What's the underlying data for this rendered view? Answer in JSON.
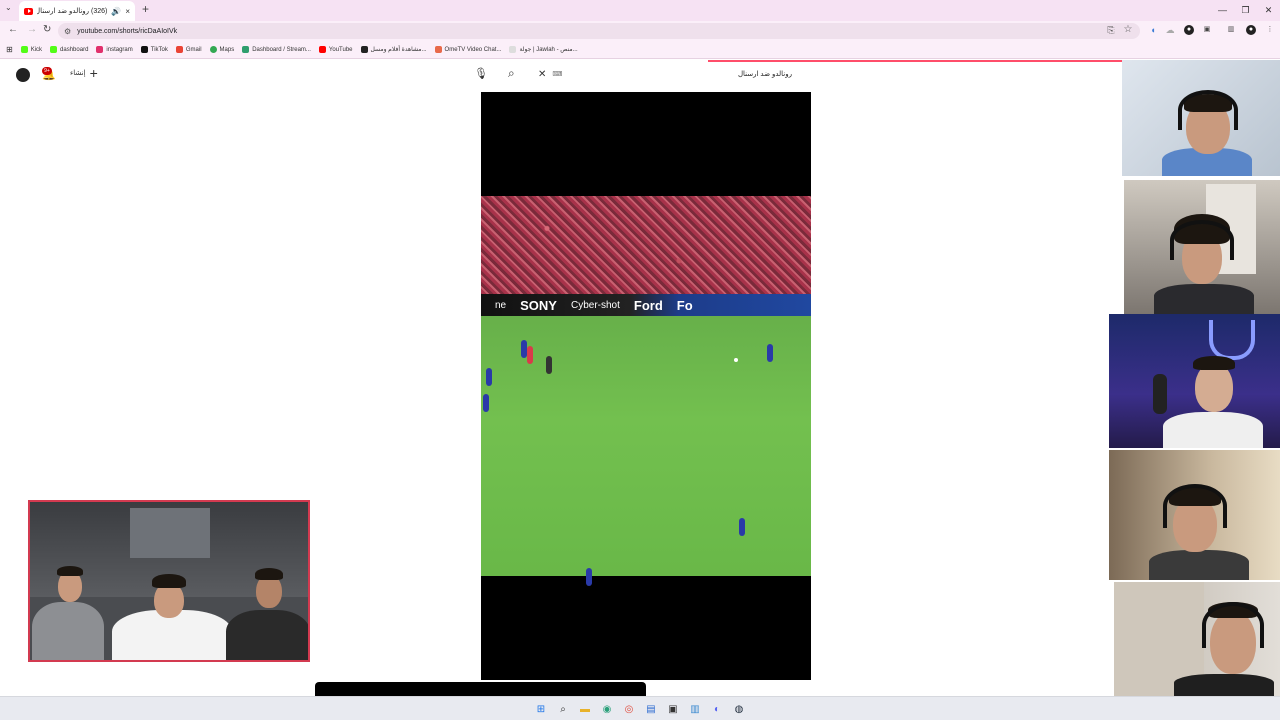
{
  "browser": {
    "tab_title": "(326) رونالدو ضد ارسنال -",
    "tab_close": "×",
    "new_tab": "+",
    "window_controls": [
      "—",
      "❐",
      "✕"
    ],
    "url": "youtube.com/shorts/ricDaAIoIVk"
  },
  "bookmarks": [
    {
      "label": "Kick",
      "color": "#53fc18"
    },
    {
      "label": "dashboard",
      "color": "#53fc18"
    },
    {
      "label": "instagram",
      "color": "#e1306c"
    },
    {
      "label": "TikTok",
      "color": "#111111"
    },
    {
      "label": "Gmail",
      "color": "#ea4335"
    },
    {
      "label": "Maps",
      "color": "#34a853"
    },
    {
      "label": "Dashboard / Stream...",
      "color": "#2f9e6e"
    },
    {
      "label": "YouTube",
      "color": "#ff0000"
    },
    {
      "label": "مشاهدة أفلام ومسل...",
      "color": "#222222"
    },
    {
      "label": "OmeTV Video Chat...",
      "color": "#e8694a"
    },
    {
      "label": "جولة | Jawlah - منص...",
      "color": "#dddddd"
    }
  ],
  "youtube": {
    "notification_count": "9+",
    "create_label": "إنشاء",
    "search_query": "رونالدو ضد ارسنال",
    "accent_color": "#ff4e6a"
  },
  "video": {
    "ad_board": [
      "ne",
      "SONY",
      "Cyber-shot",
      "Ford",
      "Fo"
    ]
  },
  "taskbar": {
    "icons": [
      "windows-start",
      "search",
      "file-explorer",
      "edge",
      "chrome",
      "app",
      "terminal",
      "notepad",
      "discord",
      "steam"
    ]
  }
}
